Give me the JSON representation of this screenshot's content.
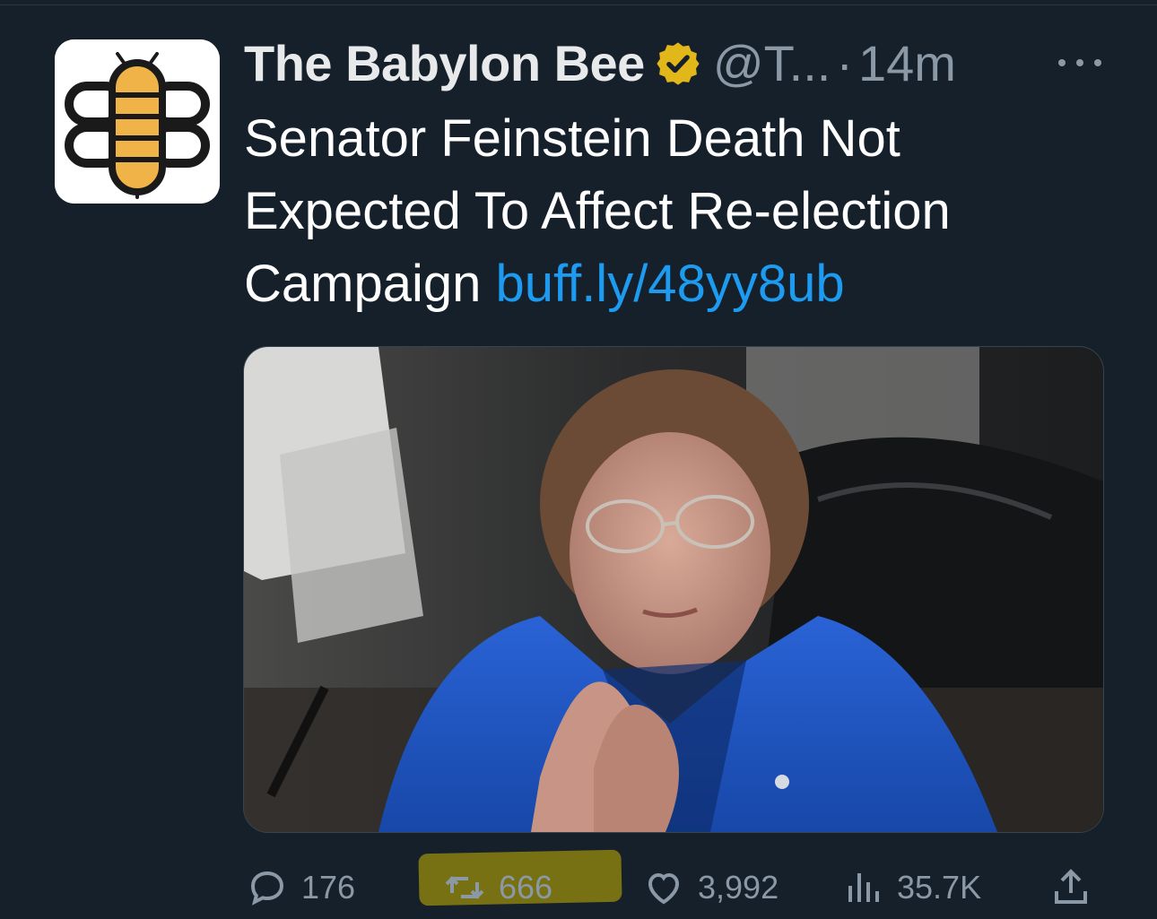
{
  "author": {
    "display_name": "The Babylon Bee",
    "handle": "@T...",
    "separator": "·",
    "time": "14m",
    "avatar_icon": "babylon-bee-logo",
    "verified_icon": "gold-verified-badge"
  },
  "tweet": {
    "text": "Senator Feinstein Death Not Expected To Affect Re-election Campaign",
    "link": "buff.ly/48yy8ub"
  },
  "media": {
    "image_icon": "photo-senator-blue-jacket"
  },
  "actions": {
    "replies": "176",
    "retweets": "666",
    "likes": "3,992",
    "views": "35.7K"
  },
  "colors": {
    "background": "#15202b",
    "link": "#1d9bf0",
    "muted": "#8b98a5",
    "verified_gold": "#e2b719",
    "highlight": "#c9b400"
  }
}
